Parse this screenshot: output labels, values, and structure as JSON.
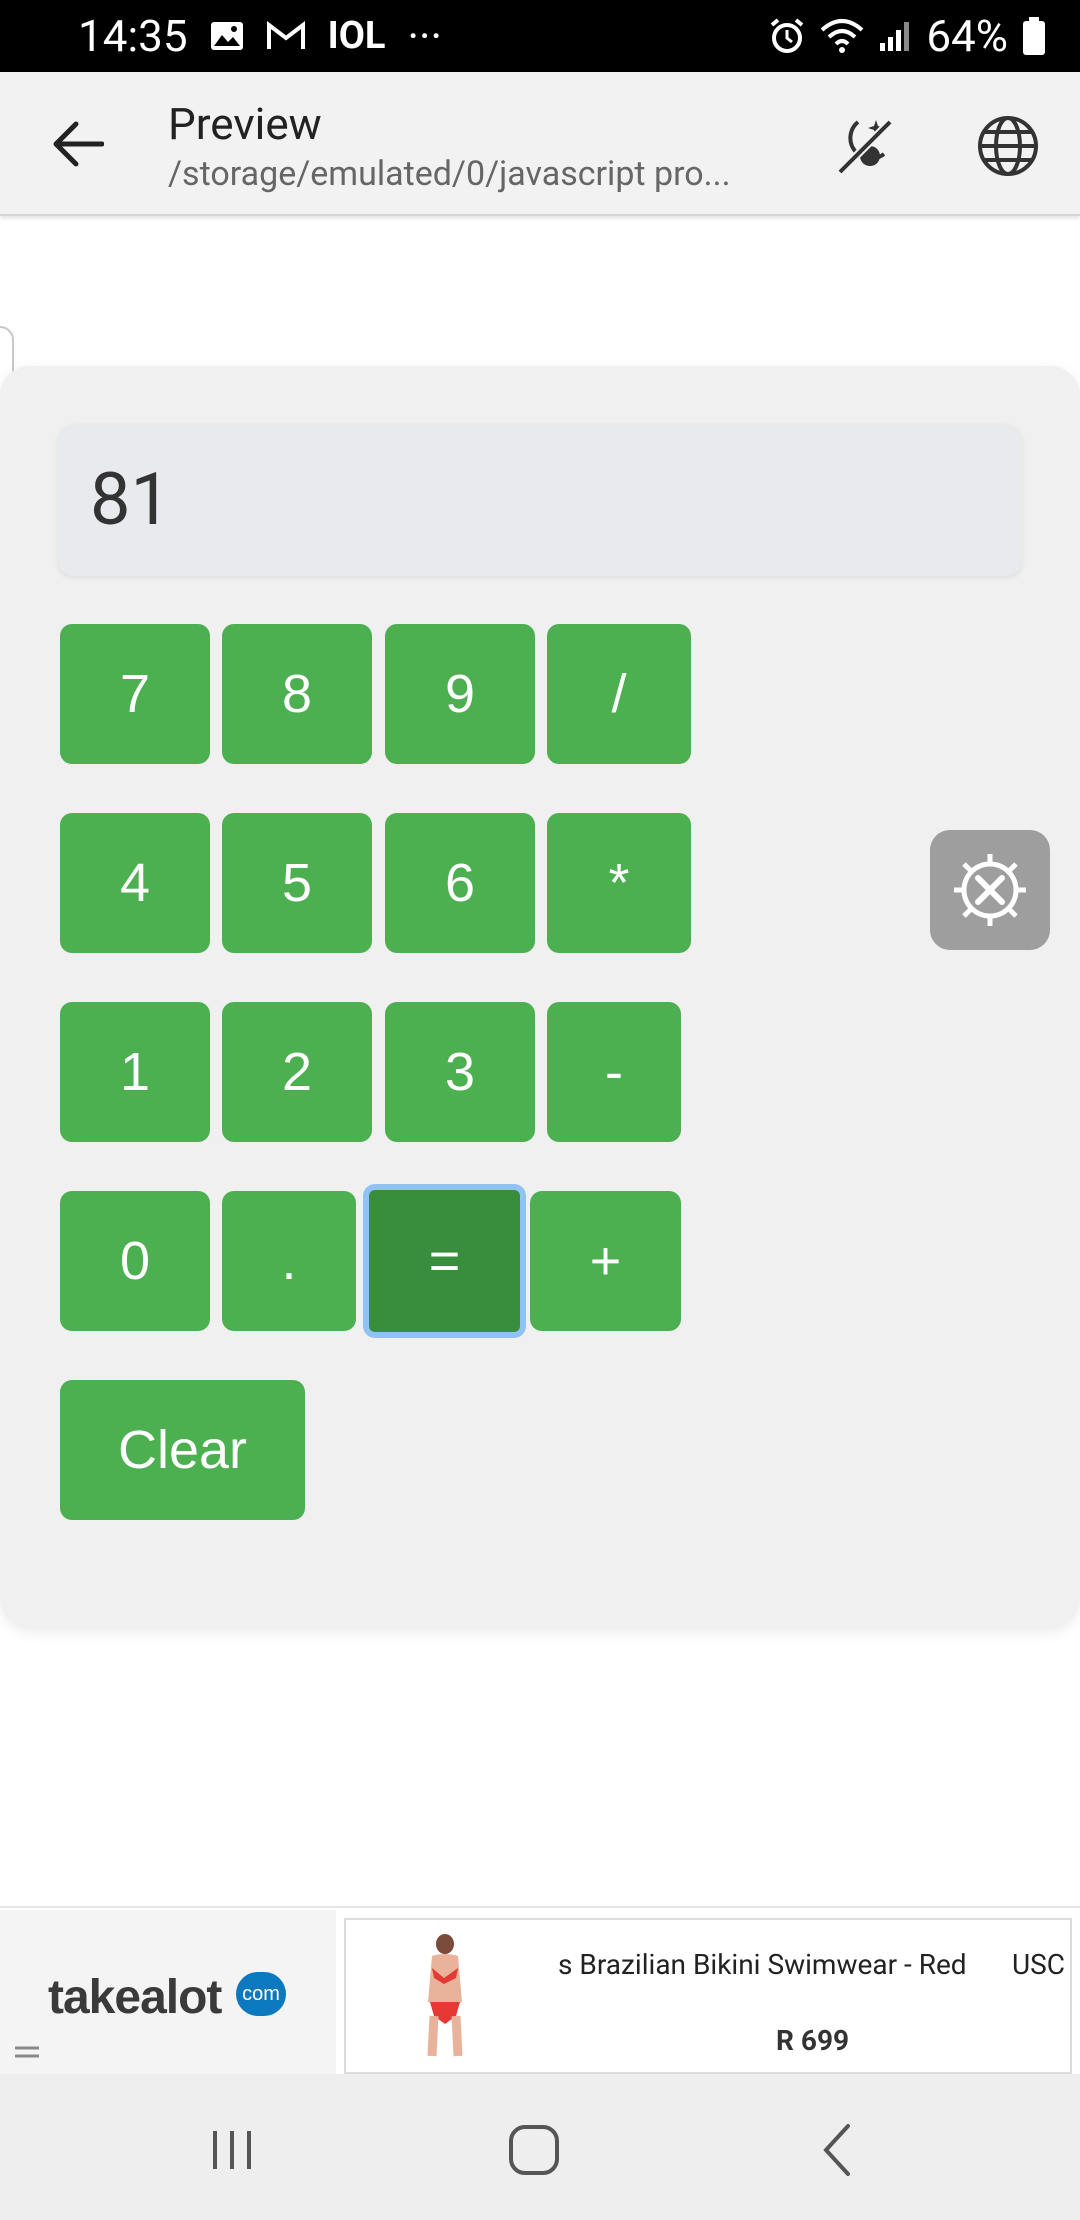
{
  "status_bar": {
    "time": "14:35",
    "carrier": "IOL",
    "more": "···",
    "battery": "64%",
    "icons": [
      "image-icon",
      "gmail-icon",
      "alarm-icon",
      "wifi-icon",
      "signal-icon",
      "battery-icon"
    ]
  },
  "app_bar": {
    "title": "Preview",
    "subtitle": "/storage/emulated/0/javascript pro..."
  },
  "calculator": {
    "display": "81",
    "rows": [
      [
        "7",
        "8",
        "9",
        "/"
      ],
      [
        "4",
        "5",
        "6",
        "*"
      ],
      [
        "1",
        "2",
        "3",
        "-"
      ],
      [
        "0",
        ".",
        "=",
        "+"
      ]
    ],
    "clear_label": "Clear",
    "active_key": "="
  },
  "ad": {
    "brand": "takealot",
    "brand_badge": "com",
    "product_title": "s Brazilian Bikini Swimwear - Red",
    "product_extra": "USC",
    "price": "R 699"
  },
  "colors": {
    "button_green": "#4caf50",
    "button_active": "#388e3c",
    "focus_ring": "#90c2f5",
    "display_bg": "#e8eaed",
    "card_bg": "#f0f0f0"
  }
}
